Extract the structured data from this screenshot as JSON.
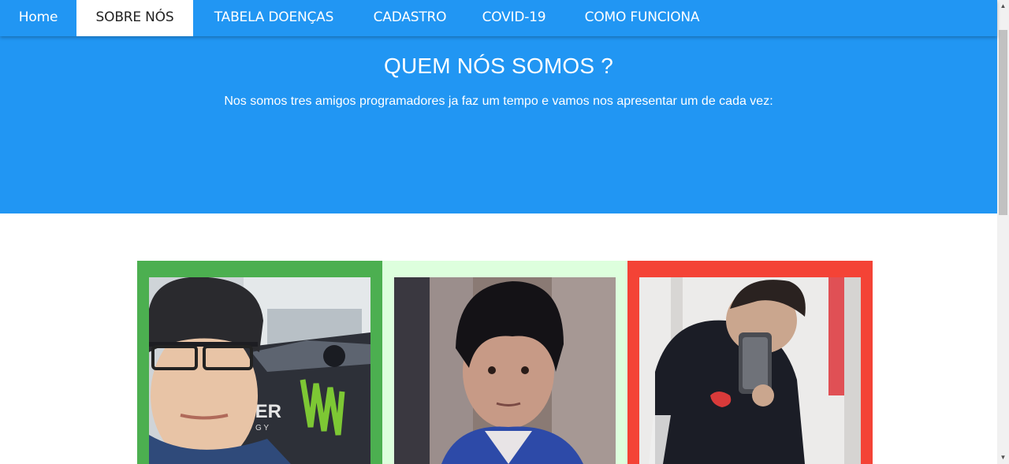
{
  "nav": {
    "items": [
      {
        "label": "Home"
      },
      {
        "label": "SOBRE NÓS"
      },
      {
        "label": "TABELA DOENÇAS"
      },
      {
        "label": "CADASTRO"
      },
      {
        "label": "COVID-19"
      },
      {
        "label": "COMO FUNCIONA"
      }
    ],
    "active_index": 1
  },
  "hero": {
    "title": "QUEM NÓS SOMOS ?",
    "subtitle": "Nos somos tres amigos programadores ja faz um tempo e vamos nos apresentar um de cada vez:"
  },
  "team": {
    "cards": [
      {
        "accent": "#4CAF50"
      },
      {
        "accent": "#DDFFDD"
      },
      {
        "accent": "#F44336"
      }
    ]
  },
  "photo_text": {
    "car_logo": "TER",
    "car_logo_small": "G Y"
  },
  "colors": {
    "primary": "#2196F3",
    "white": "#FFFFFF"
  }
}
